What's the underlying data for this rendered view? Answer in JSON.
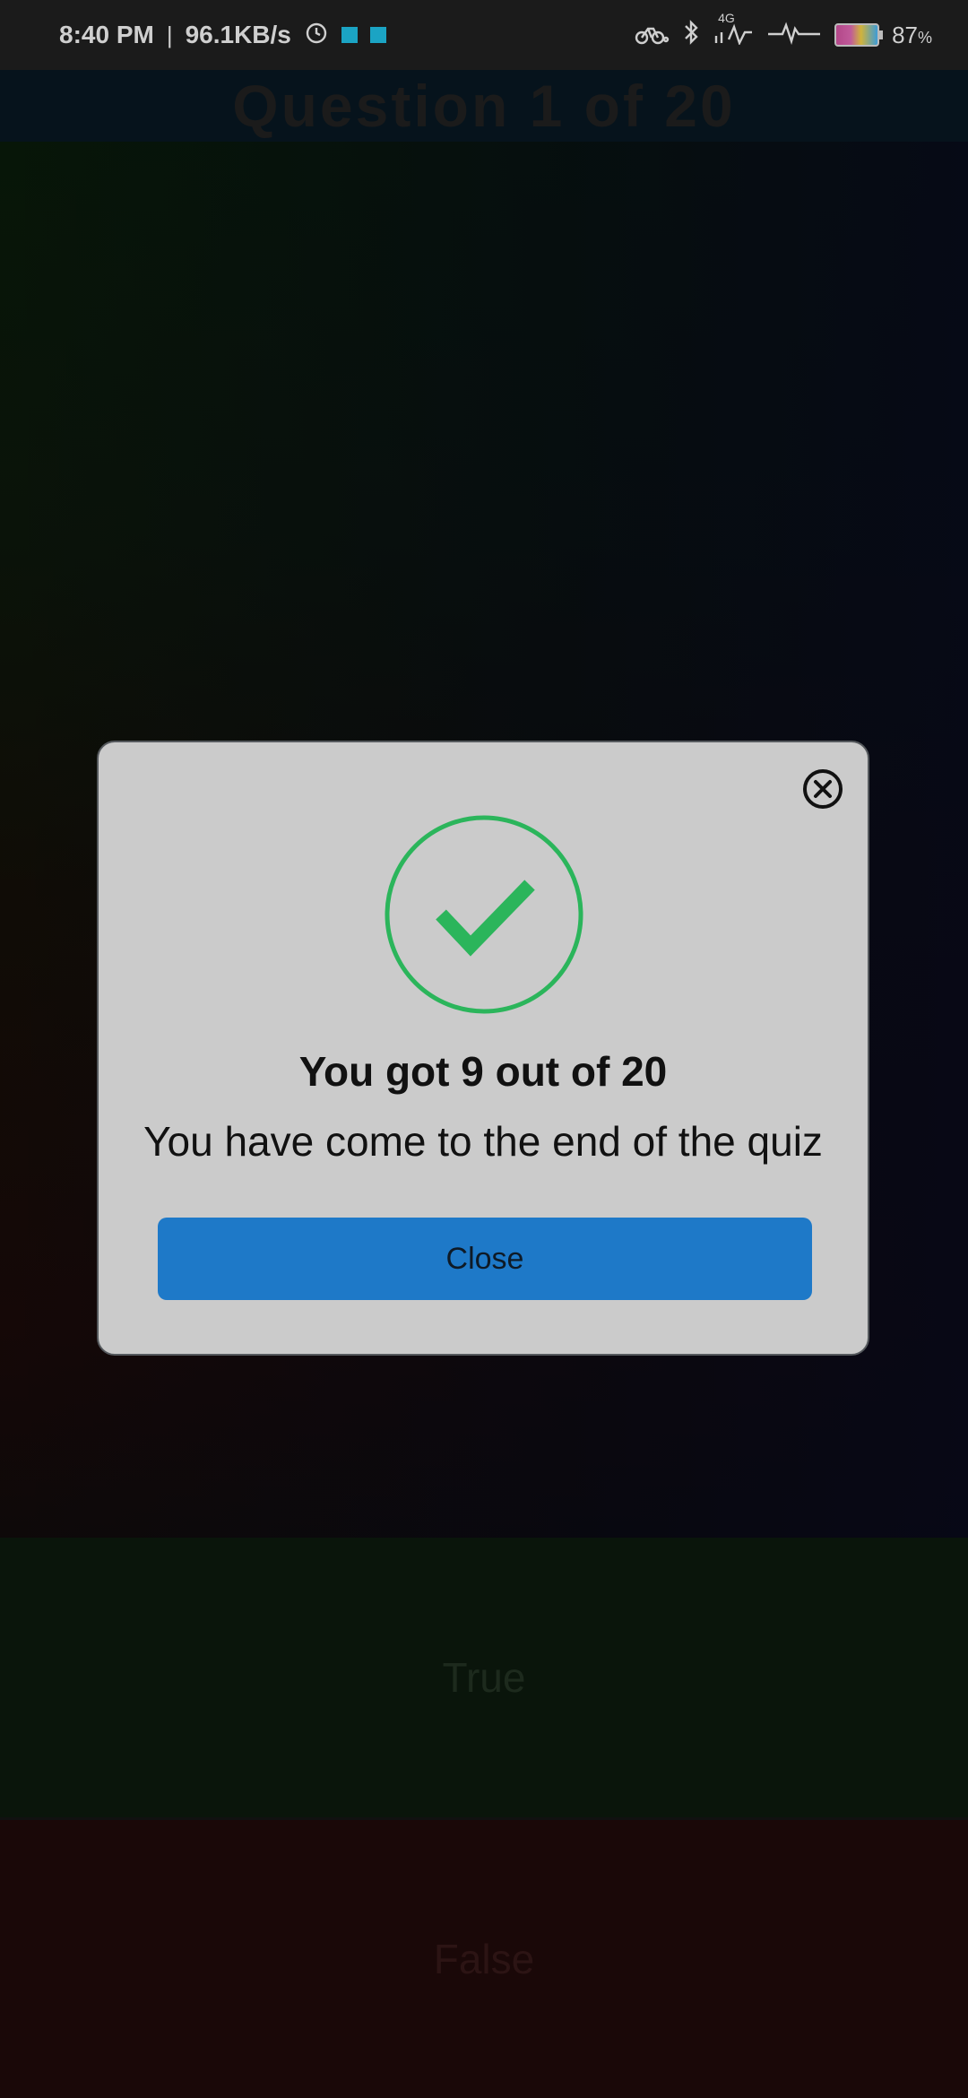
{
  "status_bar": {
    "time": "8:40 PM",
    "network_speed": "96.1KB/s",
    "network_type": "4G",
    "battery": "87",
    "battery_unit": "%",
    "icons": [
      "alarm-icon",
      "app-notification-icon",
      "app-notification-icon",
      "cycling-icon",
      "bluetooth-icon",
      "signal-icon",
      "heartbeat-icon",
      "battery-icon"
    ]
  },
  "quiz": {
    "header": "Question 1 of 20",
    "true_label": "True",
    "false_label": "False"
  },
  "modal": {
    "title": "You got 9 out of 20",
    "message": "You have come to the end of the quiz",
    "button_label": "Close",
    "icons": [
      "checkmark-circle-icon",
      "close-circle-icon"
    ]
  },
  "colors": {
    "modal_background": "#cbcbcb",
    "success_green": "#2bb55b",
    "button_blue": "#1e79c8"
  }
}
